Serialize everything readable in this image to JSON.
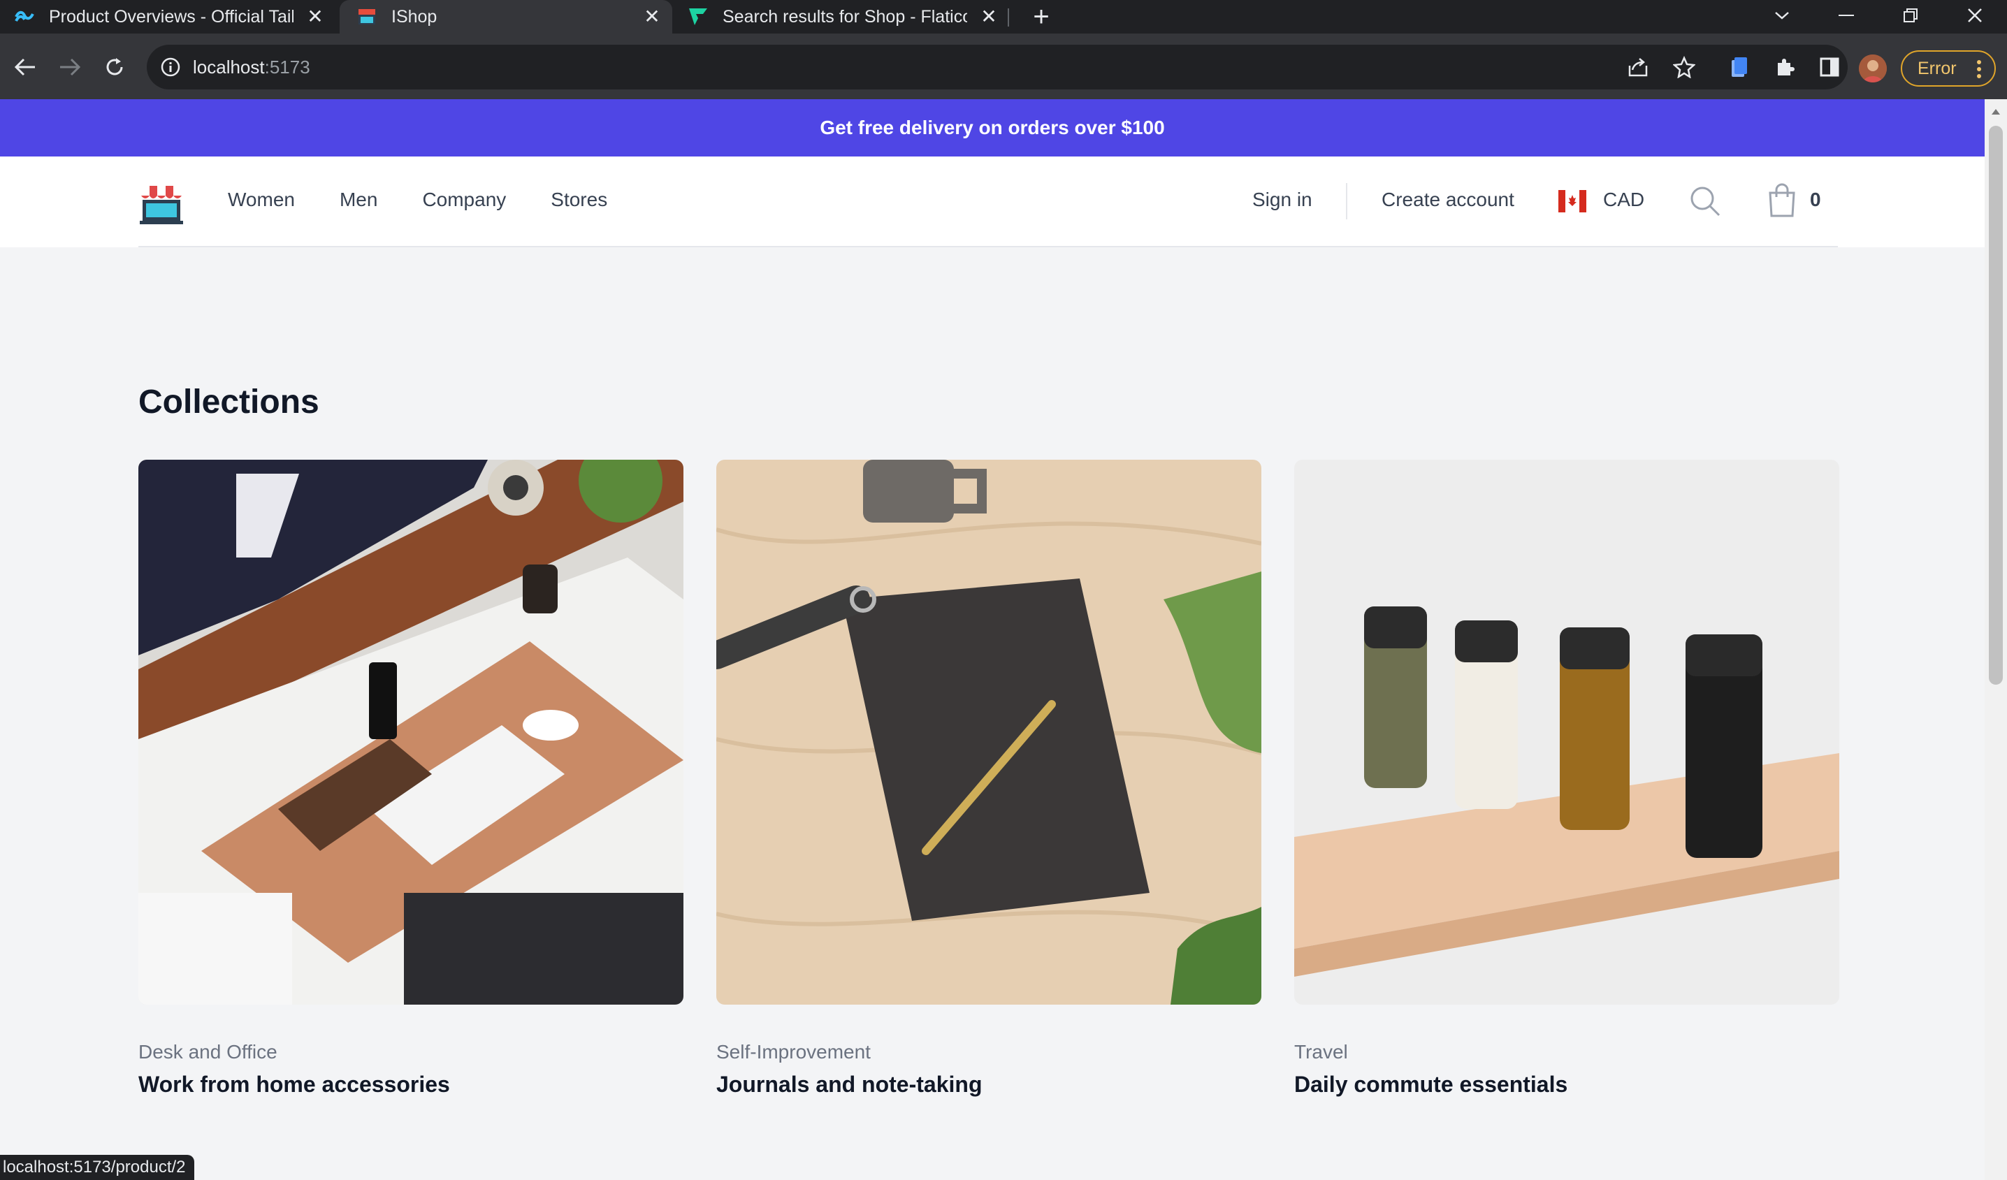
{
  "browser": {
    "tabs": [
      {
        "title": "Product Overviews - Official Tailw",
        "icon": "tailwind-icon"
      },
      {
        "title": "IShop",
        "icon": "shop-icon"
      },
      {
        "title": "Search results for Shop - Flaticon",
        "icon": "flaticon-icon"
      }
    ],
    "url_host": "localhost",
    "url_port": ":5173",
    "error_label": "Error",
    "status_url": "localhost:5173/product/2"
  },
  "promo": {
    "text": "Get free delivery on orders over $100"
  },
  "header": {
    "nav": [
      "Women",
      "Men",
      "Company",
      "Stores"
    ],
    "sign_in": "Sign in",
    "create_account": "Create account",
    "currency": "CAD",
    "cart_count": "0"
  },
  "collections": {
    "heading": "Collections",
    "items": [
      {
        "category": "Desk and Office",
        "name": "Work from home accessories"
      },
      {
        "category": "Self-Improvement",
        "name": "Journals and note-taking"
      },
      {
        "category": "Travel",
        "name": "Daily commute essentials"
      }
    ]
  },
  "colors": {
    "accent": "#4f46e5",
    "background": "#f3f4f6",
    "text": "#111827"
  }
}
